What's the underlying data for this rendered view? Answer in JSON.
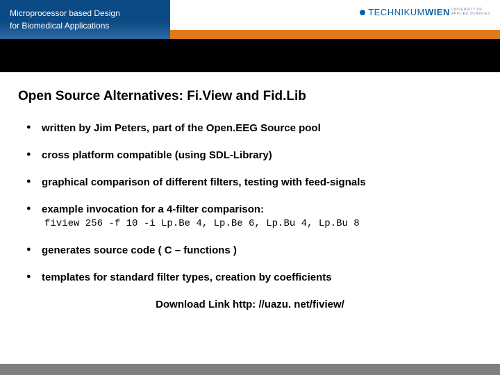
{
  "header": {
    "course_line1": "Microprocessor based Design",
    "course_line2": "for Biomedical Applications",
    "logo_main": "TECHNIKUM",
    "logo_bold": "WIEN",
    "logo_sub1": "UNIVERSITY OF",
    "logo_sub2": "APPLIED SCIENCES"
  },
  "title": "Open Source Alternatives: Fi.View and Fid.Lib",
  "bullets": [
    {
      "text": "written by Jim Peters, part of the Open.EEG Source pool"
    },
    {
      "text": "cross platform compatible (using SDL-Library)"
    },
    {
      "text": "graphical comparison of different filters, testing with feed-signals"
    },
    {
      "text": "example invocation for a 4-filter comparison:",
      "code": "fiview 256 -f 10 -i Lp.Be 4, Lp.Be 6, Lp.Bu 4, Lp.Bu 8"
    },
    {
      "text": "generates source code ( C – functions )"
    },
    {
      "text": "templates for standard filter types, creation by coefficients"
    }
  ],
  "download": "Download Link http: //uazu. net/fiview/"
}
